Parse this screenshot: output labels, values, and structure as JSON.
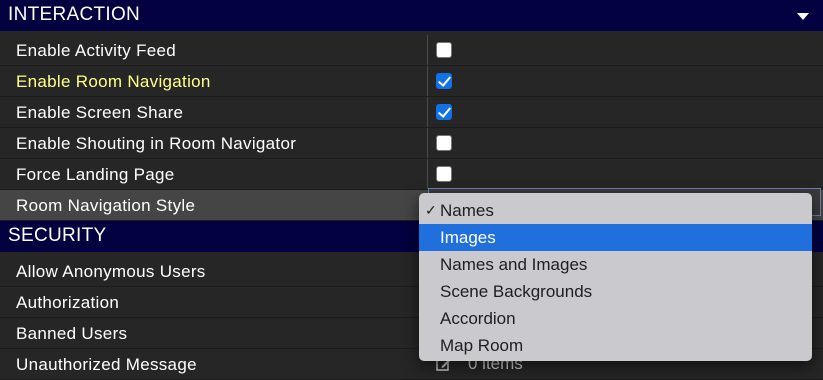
{
  "interaction": {
    "title": "INTERACTION",
    "rows": [
      {
        "label": "Enable Activity Feed",
        "checked": false
      },
      {
        "label": "Enable Room Navigation",
        "checked": true
      },
      {
        "label": "Enable Screen Share",
        "checked": true
      },
      {
        "label": "Enable Shouting in Room Navigator",
        "checked": false
      },
      {
        "label": "Force Landing Page",
        "checked": false
      }
    ],
    "nav_style_label": "Room Navigation Style"
  },
  "security": {
    "title": "SECURITY",
    "rows": [
      {
        "label": "Allow Anonymous Users"
      },
      {
        "label": "Authorization"
      },
      {
        "label": "Banned Users"
      },
      {
        "label": "Unauthorized Message"
      }
    ],
    "items_text": "0 items"
  },
  "dropdown": {
    "check_glyph": "✓",
    "options": [
      "Names",
      "Images",
      "Names and Images",
      "Scene Backgrounds",
      "Accordion",
      "Map Room"
    ],
    "selected": "Names",
    "highlighted": "Images"
  },
  "colors": {
    "header_bg": "#03013f",
    "highlight_label": "#ffff8c",
    "accent": "#1f6fdc"
  },
  "icons": {
    "collapse": "chevron-down-icon",
    "check": "checkmark-icon",
    "edit": "edit-icon"
  }
}
